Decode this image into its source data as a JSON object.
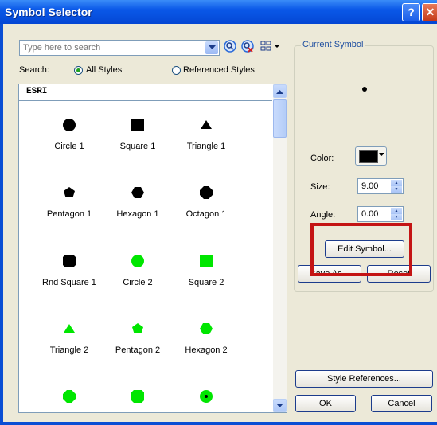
{
  "window": {
    "title": "Symbol Selector",
    "help_label": "?",
    "close_label": "✕"
  },
  "search": {
    "placeholder": "Type here to search",
    "label": "Search:",
    "option_all": "All Styles",
    "option_referenced": "Referenced Styles",
    "selected": "All Styles"
  },
  "list": {
    "header": "ESRI",
    "items": [
      {
        "label": "Circle 1",
        "shape": "circle",
        "color": "#000000"
      },
      {
        "label": "Square 1",
        "shape": "square",
        "color": "#000000"
      },
      {
        "label": "Triangle 1",
        "shape": "triangle",
        "color": "#000000"
      },
      {
        "label": "Pentagon 1",
        "shape": "pentagon",
        "color": "#000000"
      },
      {
        "label": "Hexagon 1",
        "shape": "hexagon",
        "color": "#000000"
      },
      {
        "label": "Octagon 1",
        "shape": "octagon",
        "color": "#000000"
      },
      {
        "label": "Rnd Square 1",
        "shape": "rndsquare",
        "color": "#000000"
      },
      {
        "label": "Circle 2",
        "shape": "circle",
        "color": "#00e600"
      },
      {
        "label": "Square 2",
        "shape": "square",
        "color": "#00e600"
      },
      {
        "label": "Triangle 2",
        "shape": "triangle",
        "color": "#00e600"
      },
      {
        "label": "Pentagon 2",
        "shape": "pentagon",
        "color": "#00e600"
      },
      {
        "label": "Hexagon 2",
        "shape": "hexagon",
        "color": "#00e600"
      },
      {
        "label": "",
        "shape": "octagon",
        "color": "#00e600"
      },
      {
        "label": "",
        "shape": "rndsquare",
        "color": "#00e600"
      },
      {
        "label": "",
        "shape": "dotcircle",
        "color": "#00e600"
      }
    ]
  },
  "current_symbol": {
    "title": "Current Symbol",
    "color_label": "Color:",
    "color_value": "#000000",
    "size_label": "Size:",
    "size_value": "9.00",
    "angle_label": "Angle:",
    "angle_value": "0.00",
    "edit_button": "Edit Symbol...",
    "save_as_button": "Save As...",
    "reset_button": "Reset"
  },
  "footer": {
    "style_references_button": "Style References...",
    "ok_button": "OK",
    "cancel_button": "Cancel"
  },
  "colors": {
    "title_bar": "#0a58e8",
    "dialog_bg": "#ece9d8",
    "highlight_box": "#c41414",
    "accent_green": "#00e600"
  }
}
